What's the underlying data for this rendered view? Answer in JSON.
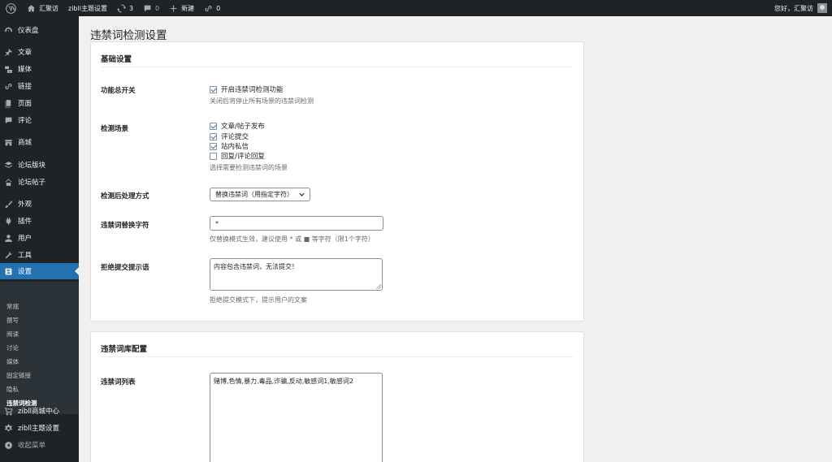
{
  "adminbar": {
    "site_name": "汇聚访",
    "theme_settings": "zibll主题设置",
    "updates_count": "3",
    "comments_count": "0",
    "new_label": "新建",
    "links_count": "0",
    "greeting": "您好，汇聚访"
  },
  "sidebar": {
    "dashboard": "仪表盘",
    "posts": "文章",
    "media": "媒体",
    "links": "链接",
    "pages": "页面",
    "comments": "评论",
    "shop": "商城",
    "forum_sections": "论坛版块",
    "forum_posts": "论坛帖子",
    "appearance": "外观",
    "plugins": "插件",
    "users": "用户",
    "tools": "工具",
    "settings": "设置",
    "submenu": {
      "general": "常规",
      "writing": "撰写",
      "reading": "阅读",
      "discussion": "讨论",
      "media": "媒体",
      "permalinks": "固定链接",
      "privacy": "隐私",
      "banned_words": "违禁词检测"
    },
    "zibll_shop_center": "zibll商城中心",
    "zibll_theme_settings": "zibll主题设置",
    "collapse_menu": "收起菜单"
  },
  "page": {
    "title": "违禁词检测设置"
  },
  "basic": {
    "title": "基础设置",
    "master_switch": {
      "label": "功能总开关",
      "checkbox_label": "开启违禁词检测功能",
      "checked": true,
      "desc": "关闭后将停止所有场景的违禁词检测"
    },
    "scenes": {
      "label": "检测场景",
      "options": [
        {
          "label": "文章/帖子发布",
          "checked": true
        },
        {
          "label": "评论提交",
          "checked": true
        },
        {
          "label": "站内私信",
          "checked": true
        },
        {
          "label": "回复/评论回复",
          "checked": false
        }
      ],
      "desc": "选择需要检测违禁词的场景"
    },
    "action": {
      "label": "检测后处理方式",
      "selected": "替换违禁词（用指定字符）"
    },
    "replace_char": {
      "label": "违禁词替换字符",
      "value": "*",
      "desc": "仅替换模式生效，建议使用 * 或 ■ 等字符（限1个字符）"
    },
    "reject_message": {
      "label": "拒绝提交提示语",
      "value": "内容包含违禁词，无法提交！",
      "desc": "拒绝提交模式下，提示用户的文案"
    }
  },
  "library": {
    "title": "违禁词库配置",
    "word_list": {
      "label": "违禁词列表",
      "value": "赌博,色情,暴力,毒品,诈骗,反动,敏感词1,敏感词2"
    }
  },
  "colors": {
    "admin_dark": "#1d2327",
    "submenu_bg": "#2c3338",
    "accent": "#2271b1",
    "page_bg": "#f0f0f1"
  }
}
